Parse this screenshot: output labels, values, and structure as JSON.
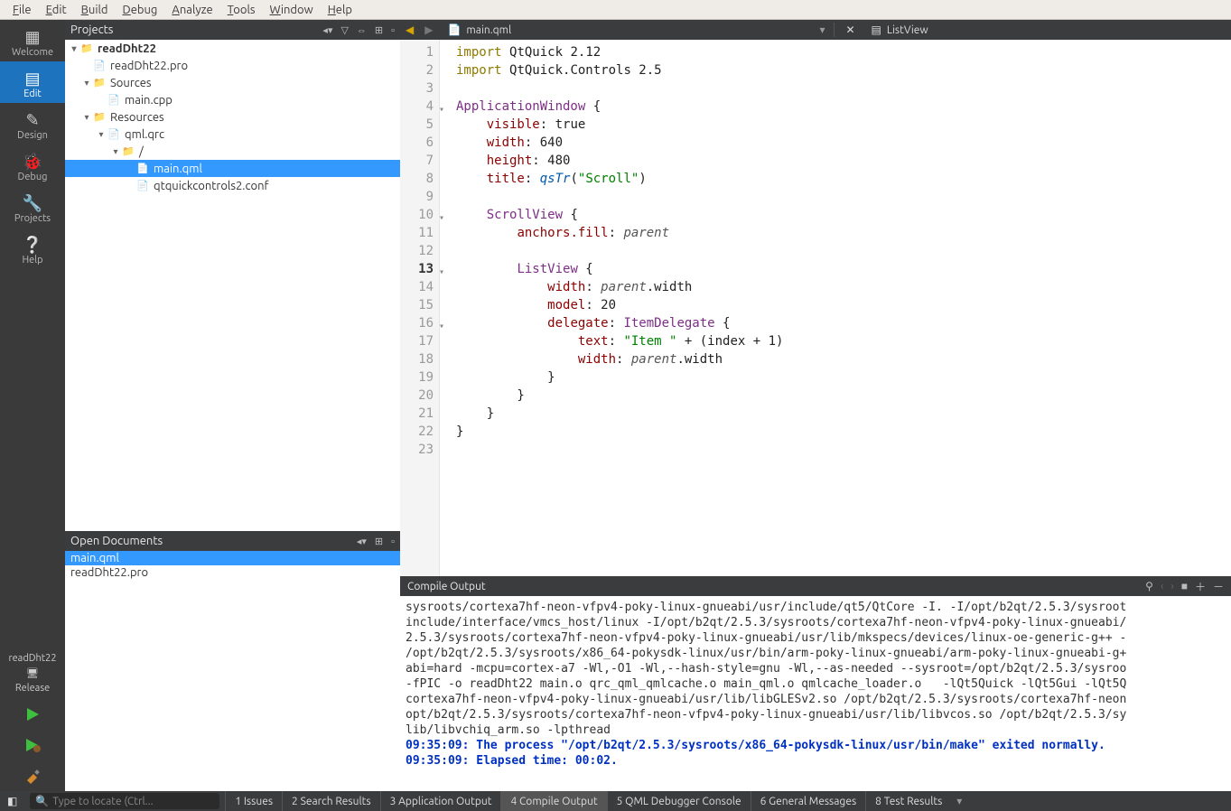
{
  "menu": [
    "File",
    "Edit",
    "Build",
    "Debug",
    "Analyze",
    "Tools",
    "Window",
    "Help"
  ],
  "leftbar": {
    "modes": [
      {
        "id": "welcome",
        "label": "Welcome"
      },
      {
        "id": "edit",
        "label": "Edit"
      },
      {
        "id": "design",
        "label": "Design"
      },
      {
        "id": "debug",
        "label": "Debug"
      },
      {
        "id": "projects",
        "label": "Projects"
      },
      {
        "id": "help",
        "label": "Help"
      }
    ],
    "kit_project": "readDht22",
    "kit_config": "Release"
  },
  "projects": {
    "title": "Projects",
    "root": "readDht22",
    "pro": "readDht22.pro",
    "sources": "Sources",
    "maincpp": "main.cpp",
    "resources": "Resources",
    "qrc": "qml.qrc",
    "slash": "/",
    "mainqml": "main.qml",
    "conf": "qtquickcontrols2.conf"
  },
  "opendocs": {
    "title": "Open Documents",
    "items": [
      "main.qml",
      "readDht22.pro"
    ]
  },
  "tabs": {
    "file": "main.qml",
    "symbol": "ListView"
  },
  "code": {
    "lines": [
      {
        "n": 1,
        "t": [
          [
            "kw",
            "import"
          ],
          [
            "",
            ""
          ],
          [
            "",
            "QtQuick"
          ],
          [
            "",
            " 2.12"
          ]
        ]
      },
      {
        "n": 2,
        "t": [
          [
            "kw",
            "import"
          ],
          [
            "",
            ""
          ],
          [
            "",
            "QtQuick.Controls"
          ],
          [
            "",
            " 2.5"
          ]
        ]
      },
      {
        "n": 3,
        "t": [
          [
            "",
            ""
          ]
        ]
      },
      {
        "n": 4,
        "fold": true,
        "t": [
          [
            "type",
            "ApplicationWindow"
          ],
          [
            "",
            " {"
          ]
        ]
      },
      {
        "n": 5,
        "t": [
          [
            "",
            "    "
          ],
          [
            "prop",
            "visible"
          ],
          [
            "",
            ": "
          ],
          [
            "",
            "true"
          ]
        ]
      },
      {
        "n": 6,
        "t": [
          [
            "",
            "    "
          ],
          [
            "prop",
            "width"
          ],
          [
            "",
            ": "
          ],
          [
            "num",
            "640"
          ]
        ]
      },
      {
        "n": 7,
        "t": [
          [
            "",
            "    "
          ],
          [
            "prop",
            "height"
          ],
          [
            "",
            ": "
          ],
          [
            "num",
            "480"
          ]
        ]
      },
      {
        "n": 8,
        "t": [
          [
            "",
            "    "
          ],
          [
            "prop",
            "title"
          ],
          [
            "",
            ": "
          ],
          [
            "func",
            "qsTr"
          ],
          [
            "",
            "("
          ],
          [
            "str",
            "\"Scroll\""
          ],
          [
            "",
            ")"
          ]
        ]
      },
      {
        "n": 9,
        "t": [
          [
            "",
            ""
          ]
        ]
      },
      {
        "n": 10,
        "fold": true,
        "t": [
          [
            "",
            "    "
          ],
          [
            "type",
            "ScrollView"
          ],
          [
            "",
            " {"
          ]
        ]
      },
      {
        "n": 11,
        "t": [
          [
            "",
            "        "
          ],
          [
            "prop",
            "anchors.fill"
          ],
          [
            "",
            ": "
          ],
          [
            "ital",
            "parent"
          ]
        ]
      },
      {
        "n": 12,
        "t": [
          [
            "",
            ""
          ]
        ]
      },
      {
        "n": 13,
        "fold": true,
        "current": true,
        "t": [
          [
            "",
            "        "
          ],
          [
            "type",
            "ListView"
          ],
          [
            "",
            " {"
          ]
        ]
      },
      {
        "n": 14,
        "t": [
          [
            "",
            "            "
          ],
          [
            "prop",
            "width"
          ],
          [
            "",
            ": "
          ],
          [
            "ital",
            "parent"
          ],
          [
            "",
            ".width"
          ]
        ]
      },
      {
        "n": 15,
        "t": [
          [
            "",
            "            "
          ],
          [
            "prop",
            "model"
          ],
          [
            "",
            ": "
          ],
          [
            "num",
            "20"
          ]
        ]
      },
      {
        "n": 16,
        "fold": true,
        "t": [
          [
            "",
            "            "
          ],
          [
            "prop",
            "delegate"
          ],
          [
            "",
            ": "
          ],
          [
            "type",
            "ItemDelegate"
          ],
          [
            "",
            " {"
          ]
        ]
      },
      {
        "n": 17,
        "t": [
          [
            "",
            "                "
          ],
          [
            "prop",
            "text"
          ],
          [
            "",
            ": "
          ],
          [
            "str",
            "\"Item \""
          ],
          [
            "",
            " + (index + "
          ],
          [
            "num",
            "1"
          ],
          [
            "",
            ")"
          ]
        ]
      },
      {
        "n": 18,
        "t": [
          [
            "",
            "                "
          ],
          [
            "prop",
            "width"
          ],
          [
            "",
            ": "
          ],
          [
            "ital",
            "parent"
          ],
          [
            "",
            ".width"
          ]
        ]
      },
      {
        "n": 19,
        "t": [
          [
            "",
            "            }"
          ]
        ]
      },
      {
        "n": 20,
        "t": [
          [
            "",
            "        }"
          ]
        ]
      },
      {
        "n": 21,
        "t": [
          [
            "",
            "    }"
          ]
        ]
      },
      {
        "n": 22,
        "t": [
          [
            "",
            "}"
          ]
        ]
      },
      {
        "n": 23,
        "t": [
          [
            "",
            ""
          ]
        ]
      }
    ]
  },
  "compile": {
    "title": "Compile Output",
    "lines": [
      "sysroots/cortexa7hf-neon-vfpv4-poky-linux-gnueabi/usr/include/qt5/QtCore -I. -I/opt/b2qt/2.5.3/sysroot",
      "include/interface/vmcs_host/linux -I/opt/b2qt/2.5.3/sysroots/cortexa7hf-neon-vfpv4-poky-linux-gnueabi/",
      "2.5.3/sysroots/cortexa7hf-neon-vfpv4-poky-linux-gnueabi/usr/lib/mkspecs/devices/linux-oe-generic-g++ -",
      "/opt/b2qt/2.5.3/sysroots/x86_64-pokysdk-linux/usr/bin/arm-poky-linux-gnueabi/arm-poky-linux-gnueabi-g+",
      "abi=hard -mcpu=cortex-a7 -Wl,-O1 -Wl,--hash-style=gnu -Wl,--as-needed --sysroot=/opt/b2qt/2.5.3/sysroo",
      "-fPIC -o readDht22 main.o qrc_qml_qmlcache.o main_qml.o qmlcache_loader.o   -lQt5Quick -lQt5Gui -lQt5Q",
      "cortexa7hf-neon-vfpv4-poky-linux-gnueabi/usr/lib/libGLESv2.so /opt/b2qt/2.5.3/sysroots/cortexa7hf-neon",
      "opt/b2qt/2.5.3/sysroots/cortexa7hf-neon-vfpv4-poky-linux-gnueabi/usr/lib/libvcos.so /opt/b2qt/2.5.3/sy",
      "lib/libvchiq_arm.so -lpthread"
    ],
    "msg1": "09:35:09: The process \"/opt/b2qt/2.5.3/sysroots/x86_64-pokysdk-linux/usr/bin/make\" exited normally.",
    "msg2": "09:35:09: Elapsed time: 00:02."
  },
  "statusbar": {
    "locator_placeholder": "Type to locate (Ctrl...",
    "panes": [
      {
        "n": "1",
        "label": "Issues"
      },
      {
        "n": "2",
        "label": "Search Results"
      },
      {
        "n": "3",
        "label": "Application Output"
      },
      {
        "n": "4",
        "label": "Compile Output",
        "active": true
      },
      {
        "n": "5",
        "label": "QML Debugger Console"
      },
      {
        "n": "6",
        "label": "General Messages"
      },
      {
        "n": "8",
        "label": "Test Results"
      }
    ]
  }
}
